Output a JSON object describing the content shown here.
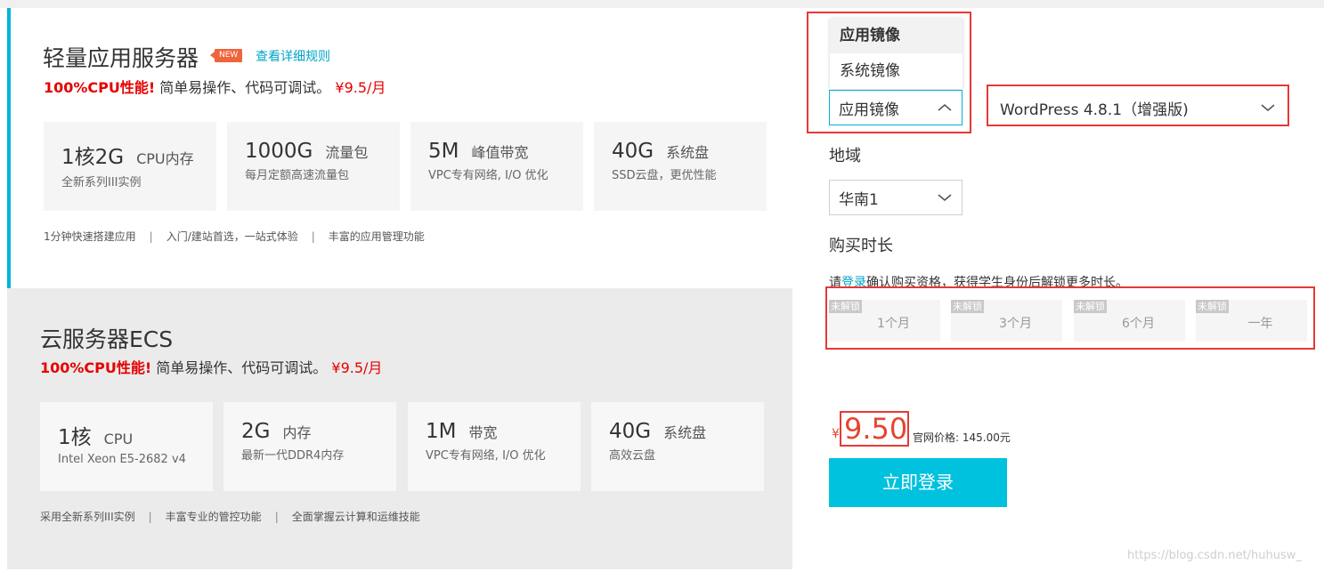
{
  "light_server": {
    "title": "轻量应用服务器",
    "badge": "NEW",
    "rules_link": "查看详细规则",
    "promo_bold": "100%CPU性能!",
    "promo_text": "简单易操作、代码可调试。",
    "promo_price": "¥9.5/月",
    "specs": [
      {
        "value": "1核2G",
        "unit": "CPU内存",
        "desc": "全新系列III实例"
      },
      {
        "value": "1000G",
        "unit": "流量包",
        "desc": "每月定额高速流量包"
      },
      {
        "value": "5M",
        "unit": "峰值带宽",
        "desc": "VPC专有网络, I/O 优化"
      },
      {
        "value": "40G",
        "unit": "系统盘",
        "desc": "SSD云盘，更优性能"
      }
    ],
    "features": [
      "1分钟快速搭建应用",
      "入门/建站首选，一站式体验",
      "丰富的应用管理功能"
    ]
  },
  "ecs": {
    "title": "云服务器ECS",
    "promo_bold": "100%CPU性能!",
    "promo_text": "简单易操作、代码可调试。",
    "promo_price": "¥9.5/月",
    "specs": [
      {
        "value": "1核",
        "unit": "CPU",
        "desc": "Intel Xeon E5-2682 v4"
      },
      {
        "value": "2G",
        "unit": "内存",
        "desc": "最新一代DDR4内存"
      },
      {
        "value": "1M",
        "unit": "带宽",
        "desc": "VPC专有网络, I/O 优化"
      },
      {
        "value": "40G",
        "unit": "系统盘",
        "desc": "高效云盘"
      }
    ],
    "features": [
      "采用全新系列III实例",
      "丰富专业的管控功能",
      "全面掌握云计算和运维技能"
    ]
  },
  "config": {
    "image_dropdown_options": [
      "应用镜像",
      "系统镜像"
    ],
    "image_type_selected": "应用镜像",
    "app_selected": "WordPress 4.8.1（增强版)",
    "region_label": "地域",
    "region_selected": "华南1",
    "duration_label": "购买时长",
    "login_note_pre": "请",
    "login_note_link": "登录",
    "login_note_post": "确认购买资格，获得学生身份后解锁更多时长。",
    "durations": [
      {
        "lock": "未解锁",
        "label": "1个月"
      },
      {
        "lock": "未解锁",
        "label": "3个月"
      },
      {
        "lock": "未解锁",
        "label": "6个月"
      },
      {
        "lock": "未解锁",
        "label": "一年"
      }
    ],
    "price_symbol": "¥",
    "price": "9.50",
    "official_price": "官网价格: 145.00元",
    "cta": "立即登录"
  },
  "watermark": "https://blog.csdn.net/huhusw_",
  "colors": {
    "accent": "#00c1de",
    "promo_red": "#e60000",
    "price_red": "#e5452f",
    "highlight_box": "#e53935"
  }
}
